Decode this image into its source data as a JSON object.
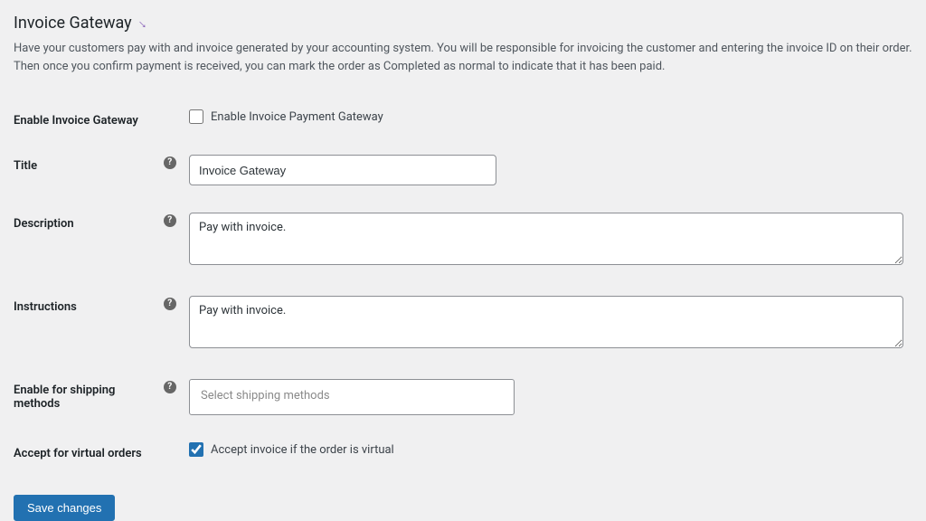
{
  "heading": "Invoice Gateway",
  "intro": "Have your customers pay with and invoice generated by your accounting system. You will be responsible for invoicing the customer and entering the invoice ID on their order. Then once you confirm payment is received, you can mark the order as Completed as normal to indicate that it has been paid.",
  "fields": {
    "enable": {
      "label": "Enable Invoice Gateway",
      "checkbox_label": "Enable Invoice Payment Gateway",
      "checked": false
    },
    "title": {
      "label": "Title",
      "value": "Invoice Gateway"
    },
    "description": {
      "label": "Description",
      "value": "Pay with invoice."
    },
    "instructions": {
      "label": "Instructions",
      "value": "Pay with invoice."
    },
    "shipping": {
      "label": "Enable for shipping methods",
      "placeholder": "Select shipping methods"
    },
    "virtual": {
      "label": "Accept for virtual orders",
      "checkbox_label": "Accept invoice if the order is virtual",
      "checked": true
    }
  },
  "save_button": "Save changes"
}
